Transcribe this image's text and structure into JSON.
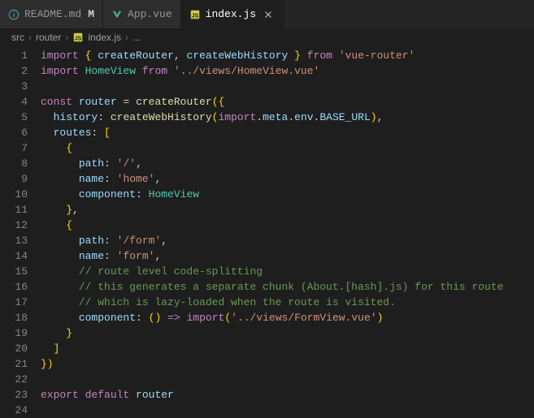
{
  "tabs": [
    {
      "label": "README.md",
      "modified": "M",
      "icon": "info"
    },
    {
      "label": "App.vue",
      "icon": "vue"
    },
    {
      "label": "index.js",
      "icon": "js",
      "active": true
    }
  ],
  "breadcrumb": {
    "p0": "src",
    "p1": "router",
    "p2": "index.js",
    "p3": "..."
  },
  "lines": {
    "n1": "1",
    "n2": "2",
    "n3": "3",
    "n4": "4",
    "n5": "5",
    "n6": "6",
    "n7": "7",
    "n8": "8",
    "n9": "9",
    "n10": "10",
    "n11": "11",
    "n12": "12",
    "n13": "13",
    "n14": "14",
    "n15": "15",
    "n16": "16",
    "n17": "17",
    "n18": "18",
    "n19": "19",
    "n20": "20",
    "n21": "21",
    "n22": "22",
    "n23": "23",
    "n24": "24"
  },
  "t": {
    "import": "import",
    "from": "from",
    "const": "const",
    "export": "export",
    "default": "default",
    "createRouter": "createRouter",
    "createWebHistory": "createWebHistory",
    "HomeView": "HomeView",
    "router": "router",
    "history": "history",
    "routes": "routes",
    "path": "path",
    "name": "name",
    "component": "component",
    "meta": "meta",
    "env": "env",
    "BASE_URL": "BASE_URL",
    "s_vueRouter": "'vue-router'",
    "s_homeView": "'../views/HomeView.vue'",
    "s_slash": "'/'",
    "s_home": "'home'",
    "s_form": "'/form'",
    "s_formn": "'form'",
    "s_formView": "'../views/FormView.vue'",
    "cmt1": "// route level code-splitting",
    "cmt2": "// this generates a separate chunk (About.[hash].js) for this route",
    "cmt3": "// which is lazy-loaded when the route is visited.",
    "arrow": "=>"
  }
}
